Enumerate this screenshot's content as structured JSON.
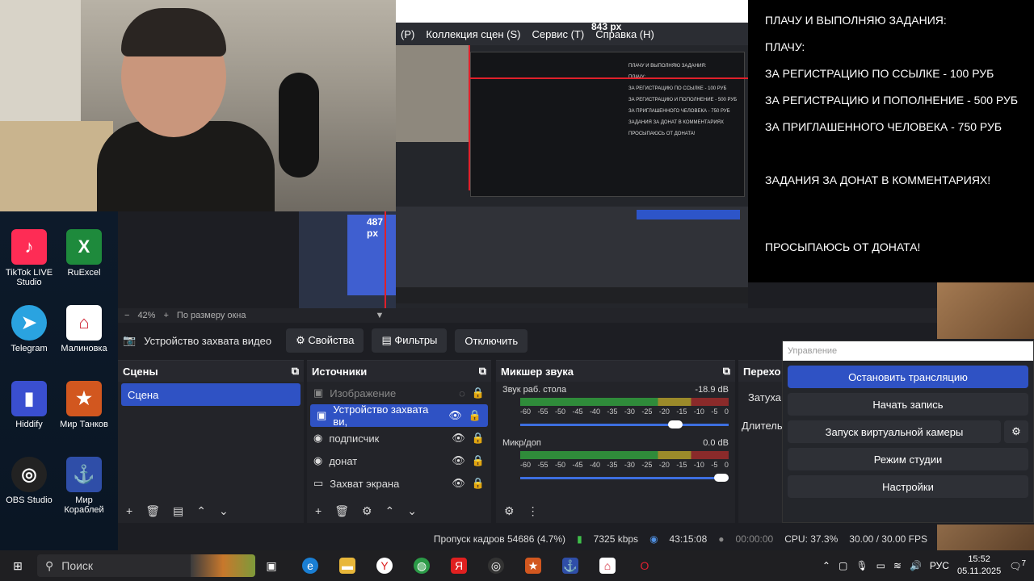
{
  "preview": {
    "menu": [
      "(P)",
      "Коллекция сцен (S)",
      "Сервис (T)",
      "Справка (H)"
    ],
    "nested_width_label": "843 px",
    "nested_height_label": "487 px",
    "nested_overlay_lines": [
      "ПЛАЧУ И ВЫПОЛНЯЮ ЗАДАНИЯ:",
      "ПЛАЧУ:",
      "ЗА РЕГИСТРАЦИЮ ПО ССЫЛКЕ - 100 РУБ",
      "ЗА РЕГИСТРАЦИЮ И ПОПОЛНЕНИЕ - 500 РУБ",
      "ЗА ПРИГЛАШЕННОГО ЧЕЛОВЕКА - 750 РУБ",
      "ЗАДАНИЯ ЗА ДОНАТ В КОММЕНТАРИЯХ",
      "ПРОСЫПАЮСЬ ОТ ДОНАТА!"
    ]
  },
  "overlay": {
    "line1": "ПЛАЧУ И ВЫПОЛНЯЮ ЗАДАНИЯ:",
    "line2": "ПЛАЧУ:",
    "line3": " ЗА РЕГИСТРАЦИЮ ПО ССЫЛКЕ - 100 РУБ",
    "line4": "ЗА РЕГИСТРАЦИЮ И ПОПОЛНЕНИЕ - 500 РУБ",
    "line5": "ЗА ПРИГЛАШЕННОГО ЧЕЛОВЕКА - 750 РУБ",
    "line6": "ЗАДАНИЯ ЗА ДОНАТ В КОММЕНТАРИЯХ!",
    "line7": "ПРОСЫПАЮСЬ ОТ ДОНАТА!"
  },
  "desktop": {
    "icons": [
      "TikTok LIVE Studio",
      "RuExcel",
      "Telegram",
      "Малиновка",
      "Hiddify",
      "Мир Танков",
      "OBS Studio",
      "Мир Кораблей"
    ]
  },
  "zoom": {
    "minus": "−",
    "value": "42%",
    "plus": "+",
    "fit": "По размеру окна"
  },
  "source_toolbar": {
    "source_name": "Устройство захвата видео",
    "properties": "Свойства",
    "filters": "Фильтры",
    "disconnect": "Отключить"
  },
  "scenes": {
    "title": "Сцены",
    "items": [
      "Сцена"
    ]
  },
  "sources": {
    "title": "Источники",
    "items": [
      "Изображение",
      "Устройство захвата ви,",
      "подписчик",
      "донат",
      "Захват экрана"
    ]
  },
  "mixer": {
    "title": "Микшер звука",
    "ticks": [
      "-60",
      "-55",
      "-50",
      "-45",
      "-40",
      "-35",
      "-30",
      "-25",
      "-20",
      "-15",
      "-10",
      "-5",
      "0"
    ],
    "channels": [
      {
        "name": "Звук раб. стола",
        "db": "-18.9 dB",
        "volume": 0.78
      },
      {
        "name": "Микр/доп",
        "db": "0.0 dB",
        "volume": 1.0
      }
    ]
  },
  "transitions": {
    "title": "Перехо",
    "fade": "Затуха",
    "duration": "Длитель"
  },
  "controls": {
    "title": "Управление",
    "stop_stream": "Остановить трансляцию",
    "start_record": "Начать запись",
    "virtual_cam": "Запуск виртуальной камеры",
    "studio_mode": "Режим студии",
    "settings": "Настройки"
  },
  "status": {
    "dropped": "Пропуск кадров 54686 (4.7%)",
    "bitrate": "7325 kbps",
    "stream_time": "43:15:08",
    "record_time": "00:00:00",
    "cpu": "CPU: 37.3%",
    "fps": "30.00 / 30.00 FPS"
  },
  "taskbar": {
    "search": "Поиск",
    "lang": "РУС",
    "time": "15:52",
    "date": "05.11.2025",
    "notifications": "7"
  },
  "colors": {
    "accent": "#2f52c4",
    "panel": "#232429",
    "bg": "#1d1e23"
  }
}
